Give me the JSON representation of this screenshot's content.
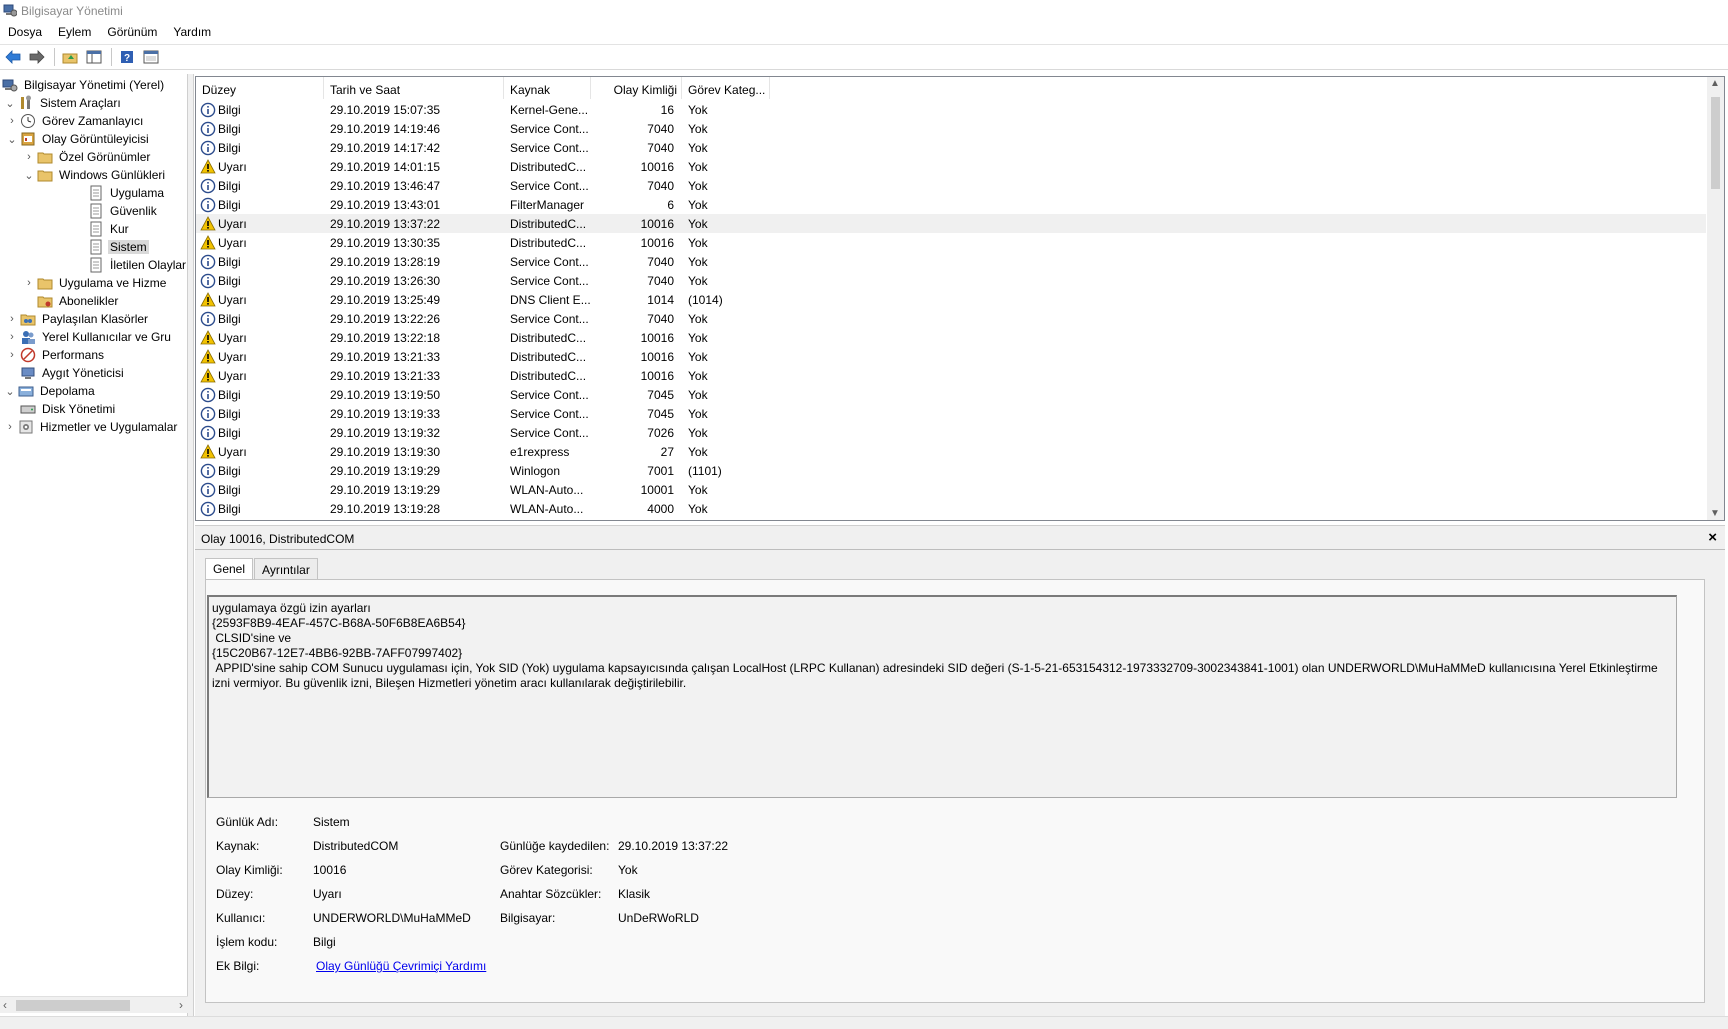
{
  "window": {
    "title": "Bilgisayar Yönetimi"
  },
  "menu": [
    "Dosya",
    "Eylem",
    "Görünüm",
    "Yardım"
  ],
  "toolbar": {
    "icons": [
      "back-arrow-icon",
      "forward-arrow-icon",
      "up-folder-icon",
      "show-hide-tree-icon",
      "help-icon",
      "properties-icon"
    ]
  },
  "tree": [
    {
      "label": "Bilgisayar Yönetimi (Yerel)",
      "expander": "",
      "icon": "computer-management-icon",
      "level": 0
    },
    {
      "label": "Sistem Araçları",
      "expander": "v",
      "icon": "tools-icon",
      "level": 0
    },
    {
      "label": "Görev Zamanlayıcı",
      "expander": ">",
      "icon": "clock-icon",
      "level": 1
    },
    {
      "label": "Olay Görüntüleyicisi",
      "expander": "v",
      "icon": "event-viewer-icon",
      "level": 1
    },
    {
      "label": "Özel Görünümler",
      "expander": ">",
      "icon": "folder-icon",
      "level": 2
    },
    {
      "label": "Windows Günlükleri",
      "expander": "v",
      "icon": "folder-icon",
      "level": 2
    },
    {
      "label": "Uygulama",
      "expander": "",
      "icon": "log-icon",
      "level": 3
    },
    {
      "label": "Güvenlik",
      "expander": "",
      "icon": "log-icon",
      "level": 3
    },
    {
      "label": "Kur",
      "expander": "",
      "icon": "log-icon",
      "level": 3
    },
    {
      "label": "Sistem",
      "expander": "",
      "icon": "log-icon",
      "level": 3,
      "selected": true
    },
    {
      "label": "İletilen Olaylar",
      "expander": "",
      "icon": "log-icon",
      "level": 3
    },
    {
      "label": "Uygulama ve Hizme",
      "expander": ">",
      "icon": "folder-icon",
      "level": 2
    },
    {
      "label": "Abonelikler",
      "expander": "",
      "icon": "subscriptions-icon",
      "level": 2
    },
    {
      "label": "Paylaşılan Klasörler",
      "expander": ">",
      "icon": "shared-folder-icon",
      "level": 1
    },
    {
      "label": "Yerel Kullanıcılar ve Gru",
      "expander": ">",
      "icon": "users-icon",
      "level": 1
    },
    {
      "label": "Performans",
      "expander": ">",
      "icon": "performance-icon",
      "level": 1
    },
    {
      "label": "Aygıt Yöneticisi",
      "expander": "",
      "icon": "device-manager-icon",
      "level": 1
    },
    {
      "label": "Depolama",
      "expander": "v",
      "icon": "storage-icon",
      "level": 0
    },
    {
      "label": "Disk Yönetimi",
      "expander": "",
      "icon": "disk-icon",
      "level": 1
    },
    {
      "label": "Hizmetler ve Uygulamalar",
      "expander": ">",
      "icon": "services-icon",
      "level": 0
    }
  ],
  "list": {
    "columns": [
      "Düzey",
      "Tarih ve Saat",
      "Kaynak",
      "Olay Kimliği",
      "Görev Kateg..."
    ],
    "rows": [
      {
        "level": "Bilgi",
        "type": "info",
        "date": "29.10.2019 15:07:35",
        "source": "Kernel-Gene...",
        "id": "16",
        "cat": "Yok"
      },
      {
        "level": "Bilgi",
        "type": "info",
        "date": "29.10.2019 14:19:46",
        "source": "Service Cont...",
        "id": "7040",
        "cat": "Yok"
      },
      {
        "level": "Bilgi",
        "type": "info",
        "date": "29.10.2019 14:17:42",
        "source": "Service Cont...",
        "id": "7040",
        "cat": "Yok"
      },
      {
        "level": "Uyarı",
        "type": "warn",
        "date": "29.10.2019 14:01:15",
        "source": "DistributedC...",
        "id": "10016",
        "cat": "Yok"
      },
      {
        "level": "Bilgi",
        "type": "info",
        "date": "29.10.2019 13:46:47",
        "source": "Service Cont...",
        "id": "7040",
        "cat": "Yok"
      },
      {
        "level": "Bilgi",
        "type": "info",
        "date": "29.10.2019 13:43:01",
        "source": "FilterManager",
        "id": "6",
        "cat": "Yok"
      },
      {
        "level": "Uyarı",
        "type": "warn",
        "date": "29.10.2019 13:37:22",
        "source": "DistributedC...",
        "id": "10016",
        "cat": "Yok",
        "selected": true
      },
      {
        "level": "Uyarı",
        "type": "warn",
        "date": "29.10.2019 13:30:35",
        "source": "DistributedC...",
        "id": "10016",
        "cat": "Yok"
      },
      {
        "level": "Bilgi",
        "type": "info",
        "date": "29.10.2019 13:28:19",
        "source": "Service Cont...",
        "id": "7040",
        "cat": "Yok"
      },
      {
        "level": "Bilgi",
        "type": "info",
        "date": "29.10.2019 13:26:30",
        "source": "Service Cont...",
        "id": "7040",
        "cat": "Yok"
      },
      {
        "level": "Uyarı",
        "type": "warn",
        "date": "29.10.2019 13:25:49",
        "source": "DNS Client E...",
        "id": "1014",
        "cat": "(1014)"
      },
      {
        "level": "Bilgi",
        "type": "info",
        "date": "29.10.2019 13:22:26",
        "source": "Service Cont...",
        "id": "7040",
        "cat": "Yok"
      },
      {
        "level": "Uyarı",
        "type": "warn",
        "date": "29.10.2019 13:22:18",
        "source": "DistributedC...",
        "id": "10016",
        "cat": "Yok"
      },
      {
        "level": "Uyarı",
        "type": "warn",
        "date": "29.10.2019 13:21:33",
        "source": "DistributedC...",
        "id": "10016",
        "cat": "Yok"
      },
      {
        "level": "Uyarı",
        "type": "warn",
        "date": "29.10.2019 13:21:33",
        "source": "DistributedC...",
        "id": "10016",
        "cat": "Yok"
      },
      {
        "level": "Bilgi",
        "type": "info",
        "date": "29.10.2019 13:19:50",
        "source": "Service Cont...",
        "id": "7045",
        "cat": "Yok"
      },
      {
        "level": "Bilgi",
        "type": "info",
        "date": "29.10.2019 13:19:33",
        "source": "Service Cont...",
        "id": "7045",
        "cat": "Yok"
      },
      {
        "level": "Bilgi",
        "type": "info",
        "date": "29.10.2019 13:19:32",
        "source": "Service Cont...",
        "id": "7026",
        "cat": "Yok"
      },
      {
        "level": "Uyarı",
        "type": "warn",
        "date": "29.10.2019 13:19:30",
        "source": "e1rexpress",
        "id": "27",
        "cat": "Yok"
      },
      {
        "level": "Bilgi",
        "type": "info",
        "date": "29.10.2019 13:19:29",
        "source": "Winlogon",
        "id": "7001",
        "cat": "(1101)"
      },
      {
        "level": "Bilgi",
        "type": "info",
        "date": "29.10.2019 13:19:29",
        "source": "WLAN-Auto...",
        "id": "10001",
        "cat": "Yok"
      },
      {
        "level": "Bilgi",
        "type": "info",
        "date": "29.10.2019 13:19:28",
        "source": "WLAN-Auto...",
        "id": "4000",
        "cat": "Yok"
      }
    ]
  },
  "detail": {
    "title": "Olay 10016, DistributedCOM",
    "close": "×",
    "tabs": [
      "Genel",
      "Ayrıntılar"
    ],
    "description": [
      "uygulamaya özgü izin ayarları",
      "{2593F8B9-4EAF-457C-B68A-50F6B8EA6B54}",
      " CLSID'sine ve",
      "{15C20B67-12E7-4BB6-92BB-7AFF07997402}",
      " APPID'sine sahip COM Sunucu uygulaması için, Yok SID (Yok) uygulama kapsayıcısında çalışan LocalHost (LRPC Kullanan) adresindeki SID değeri (S-1-5-21-653154312-1973332709-3002343841-1001) olan UNDERWORLD\\MuHaMMeD kullanıcısına Yerel Etkinleştirme izni vermiyor. Bu güvenlik izni, Bileşen Hizmetleri yönetim aracı kullanılarak değiştirilebilir."
    ],
    "props": {
      "log_name_label": "Günlük Adı:",
      "log_name": "Sistem",
      "source_label": "Kaynak:",
      "source": "DistributedCOM",
      "logged_label": "Günlüğe kaydedilen:",
      "logged": "29.10.2019 13:37:22",
      "event_id_label": "Olay Kimliği:",
      "event_id": "10016",
      "task_cat_label": "Görev Kategorisi:",
      "task_cat": "Yok",
      "level_label": "Düzey:",
      "level": "Uyarı",
      "keywords_label": "Anahtar Sözcükler:",
      "keywords": "Klasik",
      "user_label": "Kullanıcı:",
      "user": "UNDERWORLD\\MuHaMMeD",
      "computer_label": "Bilgisayar:",
      "computer": "UnDeRWoRLD",
      "opcode_label": "İşlem kodu:",
      "opcode": "Bilgi",
      "more_info_label": "Ek Bilgi:",
      "more_info_link": "Olay Günlüğü Çevrimiçi Yardımı"
    }
  },
  "colors": {
    "info": "#2b4b8c",
    "warn": "#f2c200",
    "link": "#0000ee",
    "selected_row": "#f0f0f0"
  }
}
